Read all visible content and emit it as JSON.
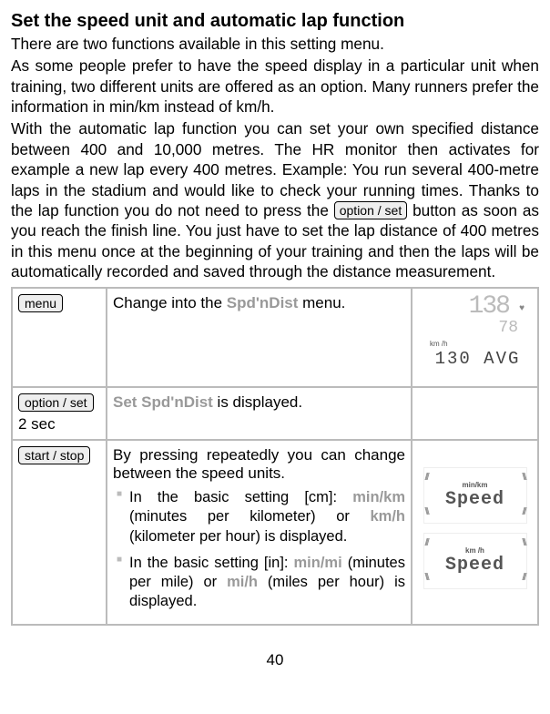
{
  "heading": "Set the speed unit and automatic lap function",
  "intro1": "There are two functions available in this setting menu.",
  "intro2": "As some people prefer to have the speed display in a particular unit when training, two different units are offered as an option. Many runners prefer the information in min/km instead of km/h.",
  "intro3a": "With the automatic lap function you can set your own specified dis­tance between 400 and 10,000 metres. The HR monitor then acti­vates for example a new lap every 400 metres. Example: You run several 400-metre laps in the stadium and would like to check your running times. Thanks to the lap function you do not need to press the ",
  "inlineBtn": "option / set",
  "intro3b": " button as soon as you reach the finish line. You just have to set the lap distance of 400 metres in this menu once at the beginning of your training and then the laps will be automatically recorded and saved through the distance measurement.",
  "rows": {
    "r1": {
      "btn": "menu",
      "text1": "Change into the ",
      "gray1": "Spd'nDist",
      "text2": " menu.",
      "lcd": {
        "line1": "138",
        "line2": "78",
        "unit": "km /h",
        "line3": "130  AVG"
      }
    },
    "r2": {
      "btn": "option / set",
      "duration": "2 sec",
      "gray1": "Set Spd'nDist",
      "text2": " is displayed."
    },
    "r3": {
      "btn": "start / stop",
      "text1": "By pressing repeatedly you can change between the speed units.",
      "b1a": "In the basic setting [cm]: ",
      "b1g1": "min/km",
      "b1b": " (minutes per kilometer) or ",
      "b1g2": "km/h",
      "b1c": " (kilometer per hour) is displayed.",
      "b2a": "In the basic setting [in]: ",
      "b2g1": "min/mi",
      "b2b": " (minutes per mile) or ",
      "b2g2": "mi/h",
      "b2c": " (miles per hour) is displayed.",
      "lcd1": {
        "unit": "min/km",
        "text": "Speed"
      },
      "lcd2": {
        "unit": "km /h",
        "text": "Speed"
      }
    }
  },
  "pageNum": "40"
}
